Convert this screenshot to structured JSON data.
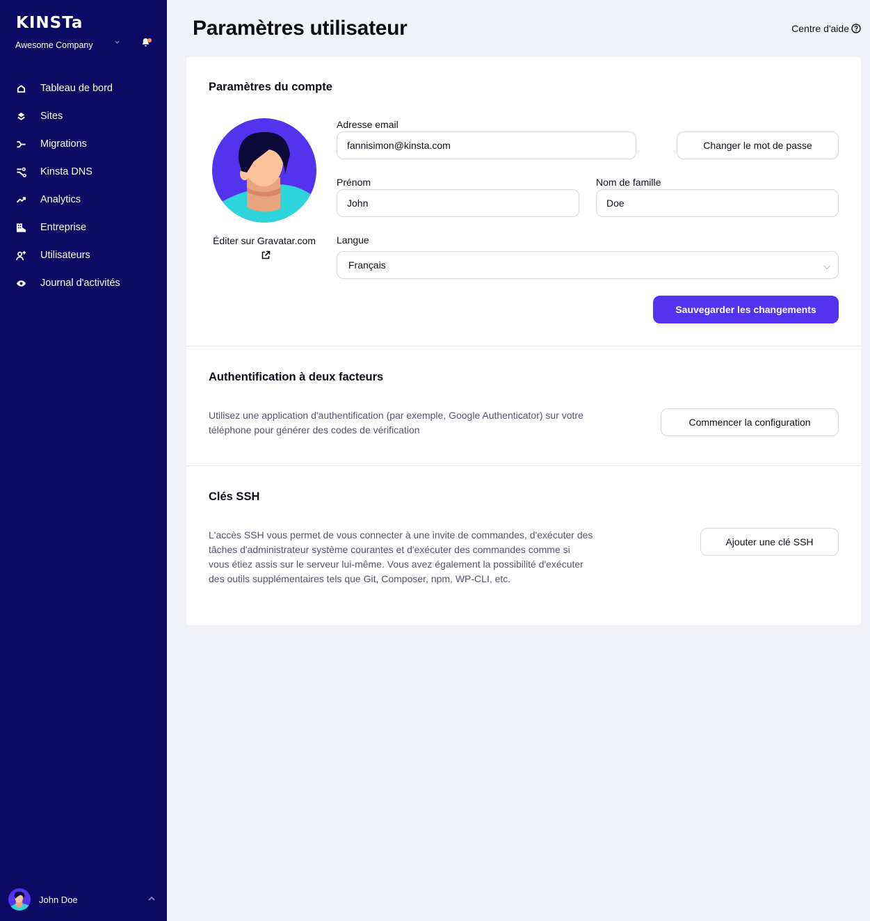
{
  "sidebar": {
    "logo": "KINSTa",
    "company": "Awesome Company",
    "notification_badge": true,
    "items": [
      {
        "label": "Tableau de bord",
        "icon": "home-icon"
      },
      {
        "label": "Sites",
        "icon": "layers-icon"
      },
      {
        "label": "Migrations",
        "icon": "migrations-icon"
      },
      {
        "label": "Kinsta DNS",
        "icon": "dns-icon"
      },
      {
        "label": "Analytics",
        "icon": "analytics-icon"
      },
      {
        "label": "Entreprise",
        "icon": "building-icon"
      },
      {
        "label": "Utilisateurs",
        "icon": "add-user-icon"
      },
      {
        "label": "Journal d'activités",
        "icon": "eye-icon"
      }
    ],
    "user": {
      "name": "John Doe"
    }
  },
  "header": {
    "title": "Paramètres utilisateur",
    "help_label": "Centre d'aide"
  },
  "account": {
    "title": "Paramètres du compte",
    "gravatar_label": "Éditer sur Gravatar.com",
    "email_label": "Adresse email",
    "email_value": "fannisimon@kinsta.com",
    "change_password_label": "Changer le mot de passe",
    "first_name_label": "Prénom",
    "first_name_value": "John",
    "last_name_label": "Nom de famille",
    "last_name_value": "Doe",
    "language_label": "Langue",
    "language_value": "Français",
    "save_label": "Sauvegarder les changements"
  },
  "two_factor": {
    "title": "Authentification à deux facteurs",
    "description_line1": "Utilisez une application d'authentification (par exemple, Google Authenticator) sur votre",
    "description_line2": "téléphone pour générer des codes de vérification",
    "button_label": "Commencer la configuration"
  },
  "ssh": {
    "title": "Clés SSH",
    "description_line1": "L'accès SSH vous permet de vous connecter à une invite de commandes, d'exécuter des",
    "description_line2": "tâches d'administrateur système courantes et d'exécuter des commandes comme si",
    "description_line3": "vous étiez assis sur le serveur lui-même. Vous avez également la possibilité d'exécuter",
    "description_line4": "des outils supplémentaires tels que Git, Composer, npm, WP-CLI, etc.",
    "button_label": "Ajouter une clé SSH"
  },
  "colors": {
    "sidebar_bg": "#0b0b63",
    "accent": "#5333ed",
    "notification_dot": "#ff8f6b",
    "page_bg": "#f2f3f8"
  }
}
